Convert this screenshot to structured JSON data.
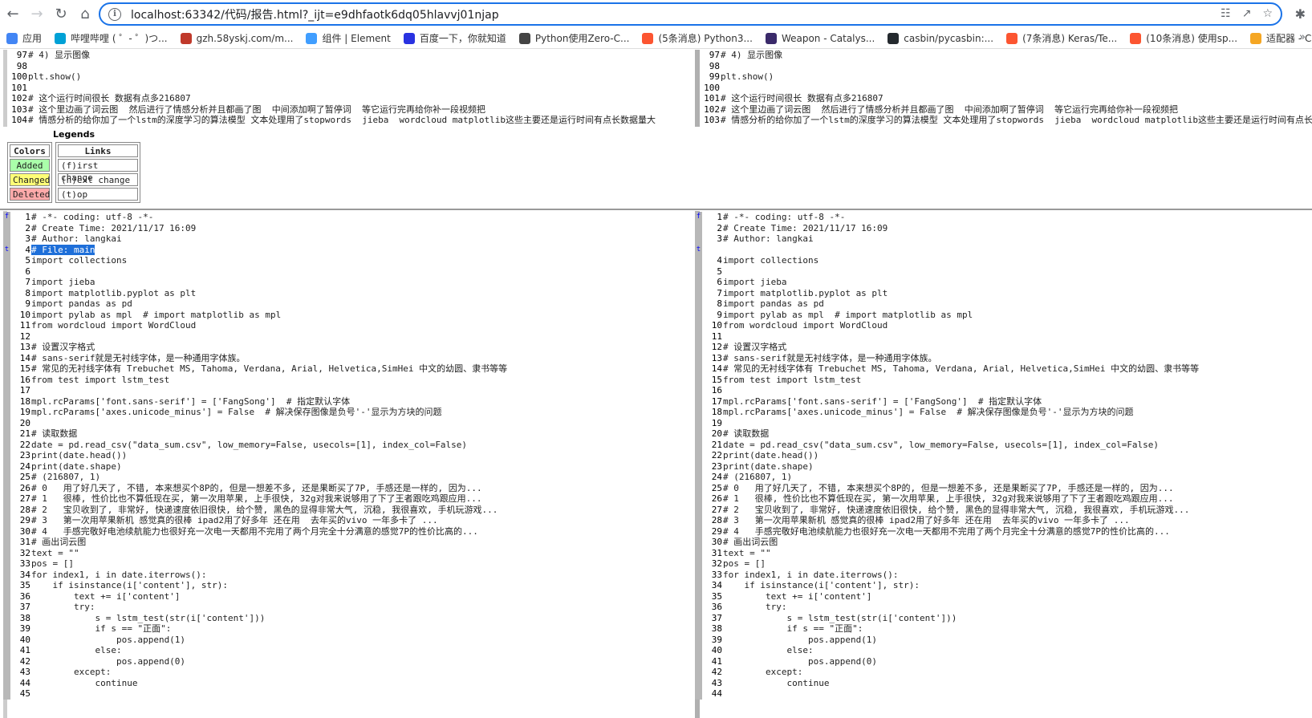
{
  "browser": {
    "url": "localhost:63342/代码/报告.html?_ijt=e9dhfaotk6dq05hlavvj01njap",
    "bookmarks": [
      {
        "label": "应用",
        "color": "#4285f4"
      },
      {
        "label": "哔哩哔哩 ( ゜- ゜)つ...",
        "color": "#00a1d6"
      },
      {
        "label": "gzh.58yskj.com/m...",
        "color": "#c0392b"
      },
      {
        "label": "组件 | Element",
        "color": "#409eff"
      },
      {
        "label": "百度一下，你就知道",
        "color": "#2932e1"
      },
      {
        "label": "Python使用Zero-C...",
        "color": "#444444"
      },
      {
        "label": "(5条消息) Python3...",
        "color": "#fc5531"
      },
      {
        "label": "Weapon - Catalys...",
        "color": "#3a2a6a"
      },
      {
        "label": "casbin/pycasbin:...",
        "color": "#24292e"
      },
      {
        "label": "(7条消息) Keras/Te...",
        "color": "#fc5531"
      },
      {
        "label": "(10条消息) 使用sp...",
        "color": "#fc5531"
      },
      {
        "label": "适配器 - Casbin 中...",
        "color": "#f5a623"
      }
    ],
    "more": "»"
  },
  "top_left": [
    {
      "n": "97",
      "t": "# 4) 显示图像"
    },
    {
      "n": "98",
      "t": ""
    },
    {
      "n": "100",
      "t": "plt.show()"
    },
    {
      "n": "101",
      "t": ""
    },
    {
      "n": "102",
      "t": "# 这个运行时间很长 数据有点多216807"
    },
    {
      "n": "103",
      "t": "# 这个里边画了词云图  然后进行了情感分析并且都画了图  中间添加啊了暂停词  等它运行完再给你补一段视频把"
    },
    {
      "n": "104",
      "t": "# 情感分析的给你加了一个lstm的深度学习的算法模型 文本处理用了stopwords  jieba  wordcloud matplotlib这些主要还是运行时间有点长数据量大"
    }
  ],
  "top_right": [
    {
      "n": "97",
      "t": "# 4) 显示图像"
    },
    {
      "n": "98",
      "t": ""
    },
    {
      "n": "99",
      "t": "plt.show()"
    },
    {
      "n": "100",
      "t": ""
    },
    {
      "n": "101",
      "t": "# 这个运行时间很长 数据有点多216807"
    },
    {
      "n": "102",
      "t": "# 这个里边画了词云图  然后进行了情感分析并且都画了图  中间添加啊了暂停词  等它运行完再给你补一段视频把"
    },
    {
      "n": "103",
      "t": "# 情感分析的给你加了一个lstm的深度学习的算法模型 文本处理用了stopwords  jieba  wordcloud matplotlib这些主要还是运行时间有点长数据量大"
    }
  ],
  "legend": {
    "title": "Legends",
    "colors_header": "Colors",
    "links_header": "Links",
    "added": "Added",
    "changed": "Changed",
    "deleted": "Deleted",
    "first": "(f)irst change",
    "next": "(n)ext change",
    "top": "(t)op"
  },
  "left": [
    {
      "n": "1",
      "t": "# -*- coding: utf-8 -*-",
      "m": "f"
    },
    {
      "n": "2",
      "t": "# Create Time: 2021/11/17 16:09"
    },
    {
      "n": "3",
      "t": "# Author: langkai"
    },
    {
      "n": "4",
      "t": "# File: main",
      "sel": true,
      "m": "t"
    },
    {
      "n": "5",
      "t": "import collections"
    },
    {
      "n": "6",
      "t": ""
    },
    {
      "n": "7",
      "t": "import jieba"
    },
    {
      "n": "8",
      "t": "import matplotlib.pyplot as plt"
    },
    {
      "n": "9",
      "t": "import pandas as pd"
    },
    {
      "n": "10",
      "t": "import pylab as mpl  # import matplotlib as mpl"
    },
    {
      "n": "11",
      "t": "from wordcloud import WordCloud"
    },
    {
      "n": "12",
      "t": ""
    },
    {
      "n": "13",
      "t": "# 设置汉字格式"
    },
    {
      "n": "14",
      "t": "# sans-serif就是无衬线字体，是一种通用字体族。"
    },
    {
      "n": "15",
      "t": "# 常见的无衬线字体有 Trebuchet MS, Tahoma, Verdana, Arial, Helvetica,SimHei 中文的幼圆、隶书等等"
    },
    {
      "n": "16",
      "t": "from test import lstm_test"
    },
    {
      "n": "17",
      "t": ""
    },
    {
      "n": "18",
      "t": "mpl.rcParams['font.sans-serif'] = ['FangSong']  # 指定默认字体"
    },
    {
      "n": "19",
      "t": "mpl.rcParams['axes.unicode_minus'] = False  # 解决保存图像是负号'-'显示为方块的问题"
    },
    {
      "n": "20",
      "t": ""
    },
    {
      "n": "21",
      "t": "# 读取数据"
    },
    {
      "n": "22",
      "t": "date = pd.read_csv(\"data_sum.csv\", low_memory=False, usecols=[1], index_col=False)"
    },
    {
      "n": "23",
      "t": "print(date.head())"
    },
    {
      "n": "24",
      "t": "print(date.shape)"
    },
    {
      "n": "25",
      "t": "# (216807, 1)"
    },
    {
      "n": "26",
      "t": "# 0   用了好几天了, 不错, 本来想买个8P的, 但是一想差不多, 还是果断买了7P, 手感还是一样的, 因为..."
    },
    {
      "n": "27",
      "t": "# 1   很棒, 性价比也不算低现在买, 第一次用苹果, 上手很快, 32g对我来说够用了下了王者跟吃鸡跟应用..."
    },
    {
      "n": "28",
      "t": "# 2   宝贝收到了, 非常好, 快递速度依旧很快, 给个赞, 黑色的显得非常大气, 沉稳, 我很喜欢, 手机玩游戏..."
    },
    {
      "n": "29",
      "t": "# 3   第一次用苹果新机 感觉真的很棒 ipad2用了好多年 还在用  去年买的vivo 一年多卡了 ..."
    },
    {
      "n": "30",
      "t": "# 4   手感完敬好电池续航能力也很好充一次电一天都用不完用了两个月完全十分满意的感觉7P的性价比高的..."
    },
    {
      "n": "31",
      "t": "# 画出词云图"
    },
    {
      "n": "32",
      "t": "text = \"\""
    },
    {
      "n": "33",
      "t": "pos = []"
    },
    {
      "n": "34",
      "t": "for index1, i in date.iterrows():"
    },
    {
      "n": "35",
      "t": "    if isinstance(i['content'], str):"
    },
    {
      "n": "36",
      "t": "        text += i['content']"
    },
    {
      "n": "37",
      "t": "        try:"
    },
    {
      "n": "38",
      "t": "            s = lstm_test(str(i['content']))"
    },
    {
      "n": "39",
      "t": "            if s == \"正面\":"
    },
    {
      "n": "40",
      "t": "                pos.append(1)"
    },
    {
      "n": "41",
      "t": "            else:"
    },
    {
      "n": "42",
      "t": "                pos.append(0)"
    },
    {
      "n": "43",
      "t": "        except:"
    },
    {
      "n": "44",
      "t": "            continue"
    },
    {
      "n": "45",
      "t": ""
    }
  ],
  "right": [
    {
      "n": "1",
      "t": "# -*- coding: utf-8 -*-",
      "m": "f"
    },
    {
      "n": "2",
      "t": "# Create Time: 2021/11/17 16:09"
    },
    {
      "n": "3",
      "t": "# Author: langkai"
    },
    {
      "n": "",
      "t": "",
      "m": "t"
    },
    {
      "n": "4",
      "t": "import collections"
    },
    {
      "n": "5",
      "t": ""
    },
    {
      "n": "6",
      "t": "import jieba"
    },
    {
      "n": "7",
      "t": "import matplotlib.pyplot as plt"
    },
    {
      "n": "8",
      "t": "import pandas as pd"
    },
    {
      "n": "9",
      "t": "import pylab as mpl  # import matplotlib as mpl"
    },
    {
      "n": "10",
      "t": "from wordcloud import WordCloud"
    },
    {
      "n": "11",
      "t": ""
    },
    {
      "n": "12",
      "t": "# 设置汉字格式"
    },
    {
      "n": "13",
      "t": "# sans-serif就是无衬线字体，是一种通用字体族。"
    },
    {
      "n": "14",
      "t": "# 常见的无衬线字体有 Trebuchet MS, Tahoma, Verdana, Arial, Helvetica,SimHei 中文的幼圆、隶书等等"
    },
    {
      "n": "15",
      "t": "from test import lstm_test"
    },
    {
      "n": "16",
      "t": ""
    },
    {
      "n": "17",
      "t": "mpl.rcParams['font.sans-serif'] = ['FangSong']  # 指定默认字体"
    },
    {
      "n": "18",
      "t": "mpl.rcParams['axes.unicode_minus'] = False  # 解决保存图像是负号'-'显示为方块的问题"
    },
    {
      "n": "19",
      "t": ""
    },
    {
      "n": "20",
      "t": "# 读取数据"
    },
    {
      "n": "21",
      "t": "date = pd.read_csv(\"data_sum.csv\", low_memory=False, usecols=[1], index_col=False)"
    },
    {
      "n": "22",
      "t": "print(date.head())"
    },
    {
      "n": "23",
      "t": "print(date.shape)"
    },
    {
      "n": "24",
      "t": "# (216807, 1)"
    },
    {
      "n": "25",
      "t": "# 0   用了好几天了, 不错, 本来想买个8P的, 但是一想差不多, 还是果断买了7P, 手感还是一样的, 因为..."
    },
    {
      "n": "26",
      "t": "# 1   很棒, 性价比也不算低现在买, 第一次用苹果, 上手很快, 32g对我来说够用了下了王者跟吃鸡跟应用..."
    },
    {
      "n": "27",
      "t": "# 2   宝贝收到了, 非常好, 快递速度依旧很快, 给个赞, 黑色的显得非常大气, 沉稳, 我很喜欢, 手机玩游戏..."
    },
    {
      "n": "28",
      "t": "# 3   第一次用苹果新机 感觉真的很棒 ipad2用了好多年 还在用  去年买的vivo 一年多卡了 ..."
    },
    {
      "n": "29",
      "t": "# 4   手感完敬好电池续航能力也很好充一次电一天都用不完用了两个月完全十分满意的感觉7P的性价比高的..."
    },
    {
      "n": "30",
      "t": "# 画出词云图"
    },
    {
      "n": "31",
      "t": "text = \"\""
    },
    {
      "n": "32",
      "t": "pos = []"
    },
    {
      "n": "33",
      "t": "for index1, i in date.iterrows():"
    },
    {
      "n": "34",
      "t": "    if isinstance(i['content'], str):"
    },
    {
      "n": "35",
      "t": "        text += i['content']"
    },
    {
      "n": "36",
      "t": "        try:"
    },
    {
      "n": "37",
      "t": "            s = lstm_test(str(i['content']))"
    },
    {
      "n": "38",
      "t": "            if s == \"正面\":"
    },
    {
      "n": "39",
      "t": "                pos.append(1)"
    },
    {
      "n": "40",
      "t": "            else:"
    },
    {
      "n": "41",
      "t": "                pos.append(0)"
    },
    {
      "n": "42",
      "t": "        except:"
    },
    {
      "n": "43",
      "t": "            continue"
    },
    {
      "n": "44",
      "t": ""
    }
  ]
}
